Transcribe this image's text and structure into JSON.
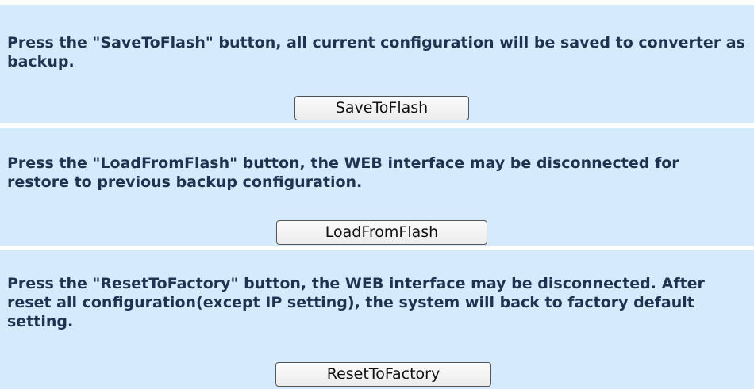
{
  "sections": [
    {
      "description": "Press the \"SaveToFlash\" button, all current configuration will be saved to converter as backup.",
      "button_label": "SaveToFlash"
    },
    {
      "description": "Press the \"LoadFromFlash\" button, the WEB interface may be disconnected for restore to previous backup configuration.",
      "button_label": "LoadFromFlash"
    },
    {
      "description": "Press the \"ResetToFactory\" button, the WEB interface may be disconnected. After reset all configuration(except IP setting), the system will back to factory default setting.",
      "button_label": "ResetToFactory"
    }
  ]
}
